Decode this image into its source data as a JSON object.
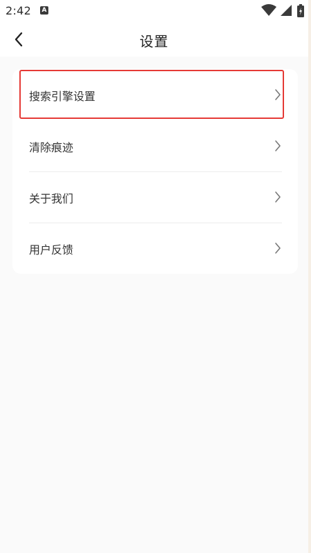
{
  "status_bar": {
    "time": "2:42",
    "notification_icon": "a-icon",
    "wifi_icon": "wifi-icon",
    "signal_icon": "signal-icon",
    "battery_icon": "battery-icon"
  },
  "header": {
    "back_icon": "chevron-left-icon",
    "title": "设置"
  },
  "settings": {
    "items": [
      {
        "label": "搜索引擎设置",
        "icon": "chevron-right-icon"
      },
      {
        "label": "清除痕迹",
        "icon": "chevron-right-icon"
      },
      {
        "label": "关于我们",
        "icon": "chevron-right-icon"
      },
      {
        "label": "用户反馈",
        "icon": "chevron-right-icon"
      }
    ]
  },
  "colors": {
    "background": "#fafafa",
    "card": "#ffffff",
    "highlight": "#e53935",
    "text": "#333333"
  }
}
